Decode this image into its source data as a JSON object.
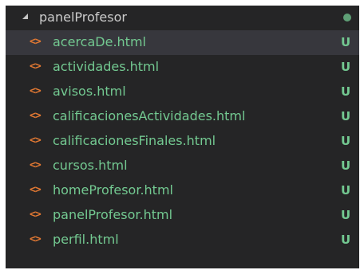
{
  "explorer": {
    "folder": {
      "name": "panelProfesor",
      "expanded": true,
      "twisty_icon": "chevron-down-icon",
      "status_dot_color": "#73c991"
    },
    "colors": {
      "background": "#252526",
      "selected_row": "#37373d",
      "untracked_green": "#73c991",
      "html_icon_orange": "#e37933"
    },
    "files": [
      {
        "name": "acercaDe.html",
        "icon": "html-file-icon",
        "icon_glyph": "<>",
        "status": "U",
        "selected": true
      },
      {
        "name": "actividades.html",
        "icon": "html-file-icon",
        "icon_glyph": "<>",
        "status": "U",
        "selected": false
      },
      {
        "name": "avisos.html",
        "icon": "html-file-icon",
        "icon_glyph": "<>",
        "status": "U",
        "selected": false
      },
      {
        "name": "calificacionesActividades.html",
        "icon": "html-file-icon",
        "icon_glyph": "<>",
        "status": "U",
        "selected": false
      },
      {
        "name": "calificacionesFinales.html",
        "icon": "html-file-icon",
        "icon_glyph": "<>",
        "status": "U",
        "selected": false
      },
      {
        "name": "cursos.html",
        "icon": "html-file-icon",
        "icon_glyph": "<>",
        "status": "U",
        "selected": false
      },
      {
        "name": "homeProfesor.html",
        "icon": "html-file-icon",
        "icon_glyph": "<>",
        "status": "U",
        "selected": false
      },
      {
        "name": "panelProfesor.html",
        "icon": "html-file-icon",
        "icon_glyph": "<>",
        "status": "U",
        "selected": false
      },
      {
        "name": "perfil.html",
        "icon": "html-file-icon",
        "icon_glyph": "<>",
        "status": "U",
        "selected": false
      }
    ]
  }
}
